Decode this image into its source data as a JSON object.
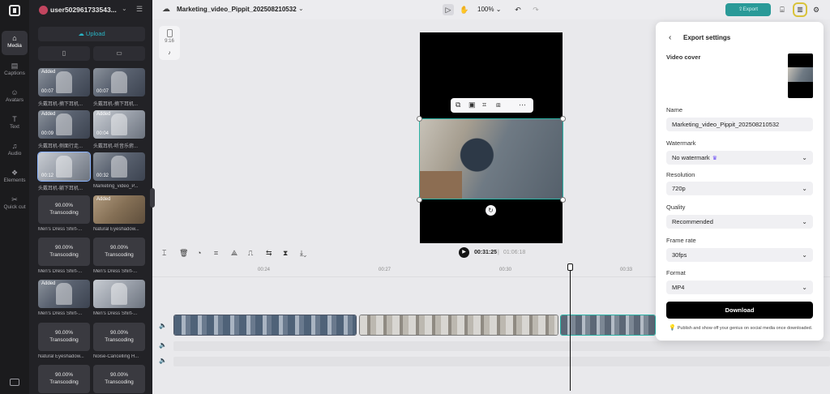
{
  "rail": {
    "items": [
      {
        "label": "Media",
        "icon": "media-icon"
      },
      {
        "label": "Captions",
        "icon": "captions-icon"
      },
      {
        "label": "Avatars",
        "icon": "avatars-icon"
      },
      {
        "label": "Text",
        "icon": "text-icon"
      },
      {
        "label": "Audio",
        "icon": "audio-icon"
      },
      {
        "label": "Elements",
        "icon": "elements-icon"
      },
      {
        "label": "Quick cut",
        "icon": "quick-cut-icon"
      }
    ]
  },
  "panel": {
    "username": "user502961733543...",
    "upload_label": "Upload",
    "tiles": [
      {
        "added": "Added",
        "duration": "00:07",
        "caption": "头戴耳机-摘下耳机..."
      },
      {
        "added": "",
        "duration": "00:07",
        "caption": "头戴耳机-摘下耳机..."
      },
      {
        "added": "Added",
        "duration": "00:09",
        "caption": "头戴耳机-侧面行走..."
      },
      {
        "added": "Added",
        "duration": "00:04",
        "caption": "头戴耳机-听音乐俯..."
      },
      {
        "added": "",
        "duration": "00:12",
        "caption": "头戴耳机-躺下耳机..."
      },
      {
        "added": "",
        "duration": "00:32",
        "caption": "Marketing_video_P..."
      },
      {
        "percent": "90.00%",
        "status": "Transcoding",
        "caption": "Men's Dress Shirt-..."
      },
      {
        "added": "Added",
        "duration": "",
        "caption": "Natural Eyeshadow..."
      },
      {
        "percent": "90.00%",
        "status": "Transcoding",
        "caption": "Men's Dress Shirt-..."
      },
      {
        "percent": "90.00%",
        "status": "Transcoding",
        "caption": "Men's Dress Shirt-..."
      },
      {
        "added": "Added",
        "duration": "",
        "caption": "Men's Dress Shirt-..."
      },
      {
        "added": "",
        "duration": "",
        "caption": "Men's Dress Shirt-..."
      },
      {
        "percent": "90.00%",
        "status": "Transcoding",
        "caption": "Natural Eyeshadow..."
      },
      {
        "percent": "90.00%",
        "status": "Transcoding",
        "caption": "Noise-Cancelling H..."
      },
      {
        "percent": "90.00%",
        "status": "Transcoding",
        "caption": ""
      },
      {
        "percent": "90.00%",
        "status": "Transcoding",
        "caption": ""
      }
    ]
  },
  "topbar": {
    "project_name": "Marketing_video_Pippit_202508210532",
    "zoom": "100%",
    "export_label": "Export"
  },
  "canvas": {
    "ratio_label": "9:16",
    "platform_glyph": "♪"
  },
  "timeline": {
    "current_time": "00:31:25",
    "separator": "|",
    "total_time": "01:06:18",
    "ticks": [
      "00:24",
      "00:27",
      "00:30",
      "00:33"
    ]
  },
  "export": {
    "title": "Export settings",
    "video_cover_label": "Video cover",
    "name_label": "Name",
    "name_value": "Marketing_video_Pippit_202508210532",
    "watermark_label": "Watermark",
    "watermark_value": "No watermark",
    "resolution_label": "Resolution",
    "resolution_value": "720p",
    "quality_label": "Quality",
    "quality_value": "Recommended",
    "framerate_label": "Frame rate",
    "framerate_value": "30fps",
    "format_label": "Format",
    "format_value": "MP4",
    "download_label": "Download",
    "tip": "Publish and show off your genius on social media once downloaded."
  },
  "colors": {
    "accent_teal": "#2a9a98",
    "selection": "#2bb3a6",
    "premium_crown": "#6a4cf5",
    "highlight_ring": "#d9c33b"
  }
}
